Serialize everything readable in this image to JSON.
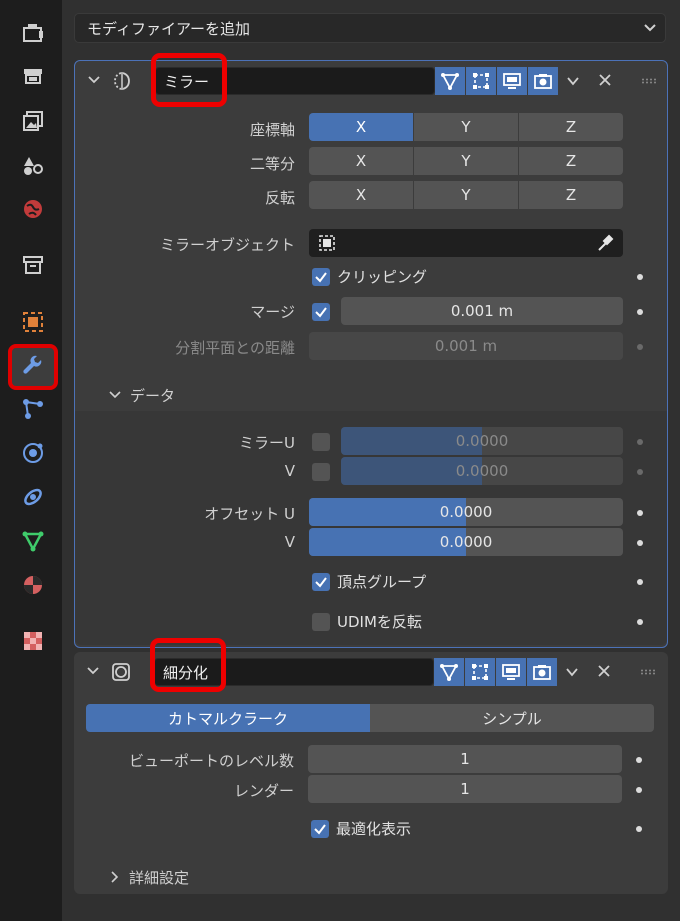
{
  "add_modifier": {
    "label": "モディファイアーを追加"
  },
  "mirror": {
    "name": "ミラー",
    "axis": {
      "label": "座標軸",
      "buttons": [
        "X",
        "Y",
        "Z"
      ],
      "active": "X"
    },
    "bisect": {
      "label": "二等分",
      "buttons": [
        "X",
        "Y",
        "Z"
      ]
    },
    "flip": {
      "label": "反転",
      "buttons": [
        "X",
        "Y",
        "Z"
      ]
    },
    "mirror_object": {
      "label": "ミラーオブジェクト",
      "value": ""
    },
    "clipping": {
      "label": "クリッピング",
      "checked": true
    },
    "merge": {
      "label": "マージ",
      "checked": true,
      "value": "0.001 m"
    },
    "bisect_distance": {
      "label": "分割平面との距離",
      "value": "0.001 m"
    },
    "data_section": {
      "label": "データ"
    },
    "mirror_u": {
      "label": "ミラーU",
      "value": "0.0000",
      "fill": 0.5
    },
    "mirror_v": {
      "label": "V",
      "value": "0.0000",
      "fill": 0.5
    },
    "offset_u": {
      "label": "オフセット U",
      "value": "0.0000",
      "fill": 0.5
    },
    "offset_v": {
      "label": "V",
      "value": "0.0000",
      "fill": 0.5
    },
    "vertex_groups": {
      "label": "頂点グループ",
      "checked": true
    },
    "flip_udim": {
      "label": "UDIMを反転",
      "checked": false
    }
  },
  "subsurf": {
    "name": "細分化",
    "mode_tabs": [
      "カトマルクラーク",
      "シンプル"
    ],
    "active_mode": "カトマルクラーク",
    "viewport_levels": {
      "label": "ビューポートのレベル数",
      "value": "1"
    },
    "render_levels": {
      "label": "レンダー",
      "value": "1"
    },
    "optimal_display": {
      "label": "最適化表示",
      "checked": true
    },
    "advanced": {
      "label": "詳細設定"
    }
  },
  "colors": {
    "accent": "#4772b3",
    "highlight": "#ee0000"
  }
}
